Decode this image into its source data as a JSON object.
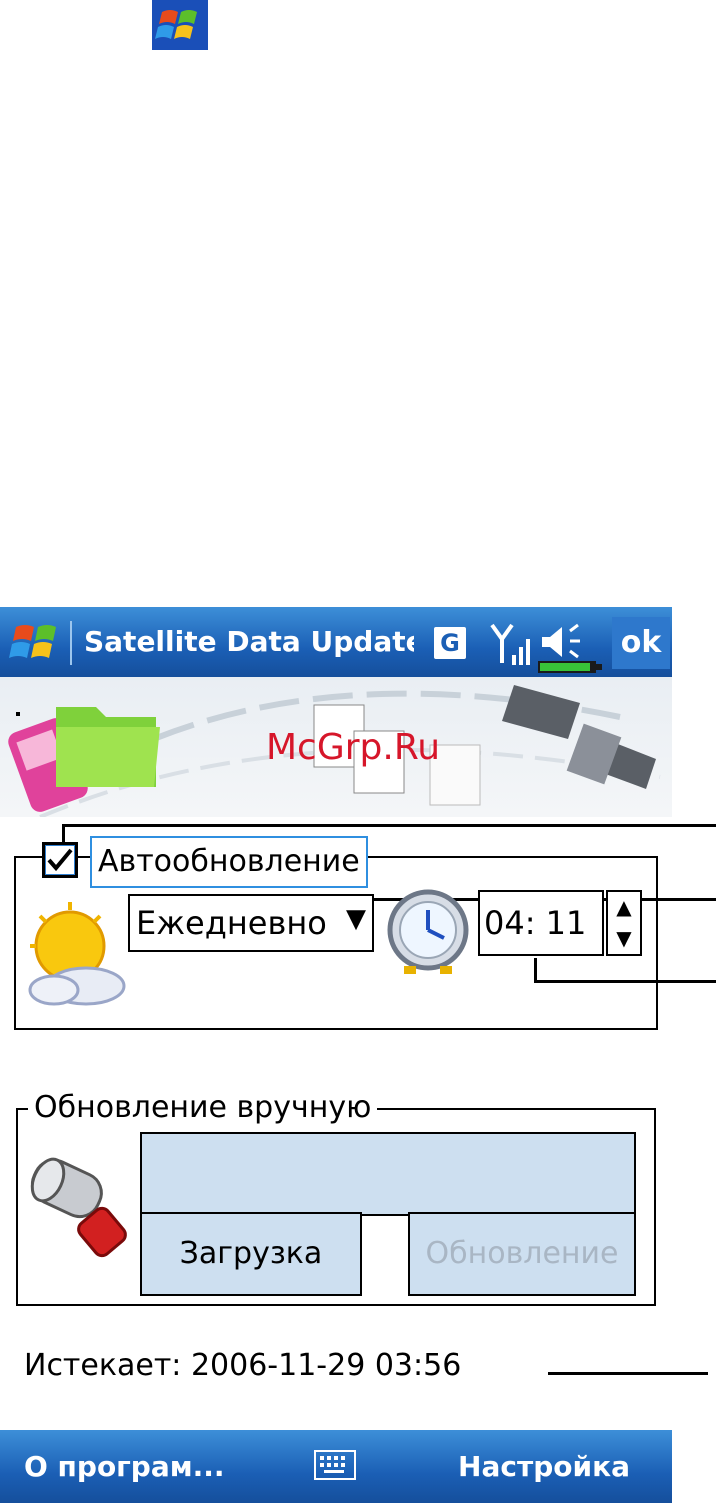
{
  "titlebar": {
    "title": "Satellite Data Update",
    "g_label": "G",
    "ok_label": "ok"
  },
  "banner": {
    "watermark": "McGrp.Ru"
  },
  "auto_update": {
    "checkbox_checked": true,
    "label": "Автообновление",
    "frequency_selected": "Ежедневно",
    "time_value": "04: 11"
  },
  "manual_update": {
    "legend": "Обновление вручную",
    "progress_value": "",
    "download_label": "Загрузка",
    "update_label": "Обновление"
  },
  "status": {
    "expires": "Истекает: 2006-11-29 03:56"
  },
  "menubar": {
    "left_label": "О програм...",
    "right_label": "Настройка"
  },
  "colors": {
    "titlebar_blue": "#1b5fb5",
    "button_fill": "#cddff0",
    "watermark_red": "#d6162a",
    "focus_blue": "#2f8fe0"
  },
  "icons": [
    "windows-start-icon",
    "gprs-icon",
    "signal-icon",
    "speaker-icon",
    "battery-icon",
    "phone-icon",
    "folder-icon",
    "documents-icon",
    "satellite-icon",
    "weather-icon",
    "clock-icon",
    "hammer-icon",
    "keyboard-icon"
  ]
}
